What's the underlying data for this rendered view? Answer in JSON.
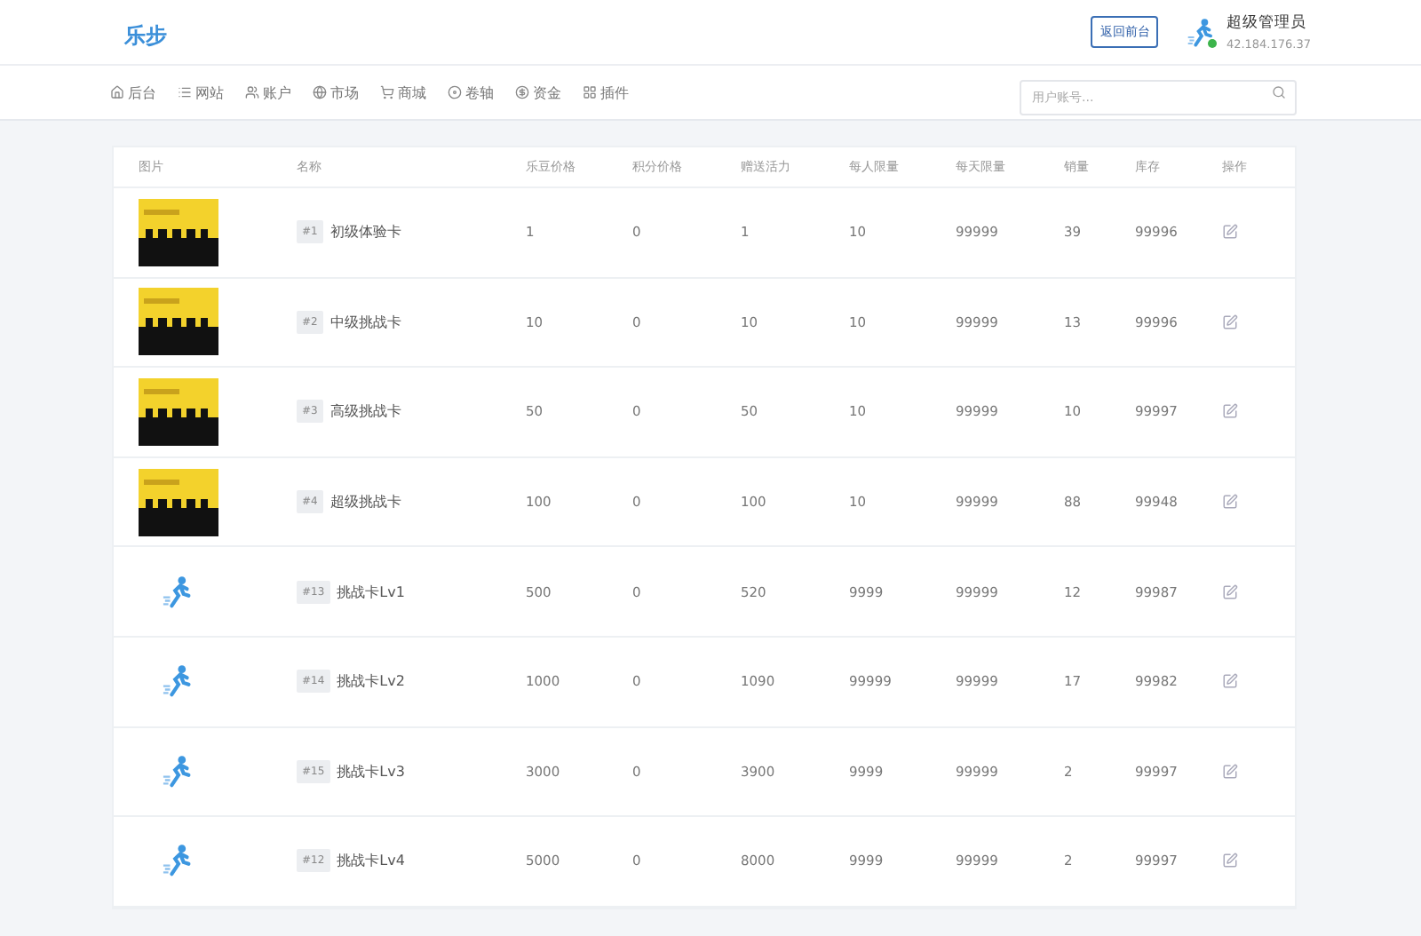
{
  "header": {
    "logo": "乐步",
    "back_button": "返回前台",
    "user": {
      "name": "超级管理员",
      "ip": "42.184.176.37",
      "online": true
    }
  },
  "nav": {
    "items": [
      {
        "label": "后台"
      },
      {
        "label": "网站"
      },
      {
        "label": "账户"
      },
      {
        "label": "市场"
      },
      {
        "label": "商城"
      },
      {
        "label": "卷轴"
      },
      {
        "label": "资金"
      },
      {
        "label": "插件"
      }
    ],
    "search": {
      "placeholder": "用户账号..."
    }
  },
  "table": {
    "columns": [
      "图片",
      "名称",
      "乐豆价格",
      "积分价格",
      "赠送活力",
      "每人限量",
      "每天限量",
      "销量",
      "库存",
      "操作"
    ],
    "rows": [
      {
        "kind": "card",
        "cells": [
          {
            "kind": "image"
          },
          {
            "kind": "name",
            "tag": "#1",
            "text": "初级体验卡"
          },
          {
            "text": "1"
          },
          {
            "text": "0"
          },
          {
            "text": "1"
          },
          {
            "text": "10"
          },
          {
            "text": "99999"
          },
          {
            "text": "39"
          },
          {
            "text": "99996"
          },
          {
            "kind": "edit"
          }
        ]
      },
      {
        "kind": "card",
        "cells": [
          {
            "kind": "image"
          },
          {
            "kind": "name",
            "tag": "#2",
            "text": "中级挑战卡"
          },
          {
            "text": "10"
          },
          {
            "text": "0"
          },
          {
            "text": "10"
          },
          {
            "text": "10"
          },
          {
            "text": "99999"
          },
          {
            "text": "13"
          },
          {
            "text": "99996"
          },
          {
            "kind": "edit"
          }
        ]
      },
      {
        "kind": "card",
        "cells": [
          {
            "kind": "image"
          },
          {
            "kind": "name",
            "tag": "#3",
            "text": "高级挑战卡"
          },
          {
            "text": "50"
          },
          {
            "text": "0"
          },
          {
            "text": "50"
          },
          {
            "text": "10"
          },
          {
            "text": "99999"
          },
          {
            "text": "10"
          },
          {
            "text": "99997"
          },
          {
            "kind": "edit"
          }
        ]
      },
      {
        "kind": "card",
        "cells": [
          {
            "kind": "image"
          },
          {
            "kind": "name",
            "tag": "#4",
            "text": "超级挑战卡"
          },
          {
            "text": "100"
          },
          {
            "text": "0"
          },
          {
            "text": "100"
          },
          {
            "text": "10"
          },
          {
            "text": "99999"
          },
          {
            "text": "88"
          },
          {
            "text": "99948"
          },
          {
            "kind": "edit"
          }
        ]
      },
      {
        "kind": "runner",
        "cells": [
          {
            "kind": "image"
          },
          {
            "kind": "name",
            "tag": "#13",
            "text": "挑战卡Lv1"
          },
          {
            "text": "500"
          },
          {
            "text": "0"
          },
          {
            "text": "520"
          },
          {
            "text": "9999"
          },
          {
            "text": "99999"
          },
          {
            "text": "12"
          },
          {
            "text": "99987"
          },
          {
            "kind": "edit"
          }
        ]
      },
      {
        "kind": "runner",
        "cells": [
          {
            "kind": "image"
          },
          {
            "kind": "name",
            "tag": "#14",
            "text": "挑战卡Lv2"
          },
          {
            "text": "1000"
          },
          {
            "text": "0"
          },
          {
            "text": "1090"
          },
          {
            "text": "99999"
          },
          {
            "text": "99999"
          },
          {
            "text": "17"
          },
          {
            "text": "99982"
          },
          {
            "kind": "edit"
          }
        ]
      },
      {
        "kind": "runner",
        "cells": [
          {
            "kind": "image"
          },
          {
            "kind": "name",
            "tag": "#15",
            "text": "挑战卡Lv3"
          },
          {
            "text": "3000"
          },
          {
            "text": "0"
          },
          {
            "text": "3900"
          },
          {
            "text": "9999"
          },
          {
            "text": "99999"
          },
          {
            "text": "2"
          },
          {
            "text": "99997"
          },
          {
            "kind": "edit"
          }
        ]
      },
      {
        "kind": "runner",
        "cells": [
          {
            "kind": "image"
          },
          {
            "kind": "name",
            "tag": "#12",
            "text": "挑战卡Lv4"
          },
          {
            "text": "5000"
          },
          {
            "text": "0"
          },
          {
            "text": "8000"
          },
          {
            "text": "9999"
          },
          {
            "text": "99999"
          },
          {
            "text": "2"
          },
          {
            "text": "99997"
          },
          {
            "kind": "edit"
          }
        ]
      }
    ]
  }
}
